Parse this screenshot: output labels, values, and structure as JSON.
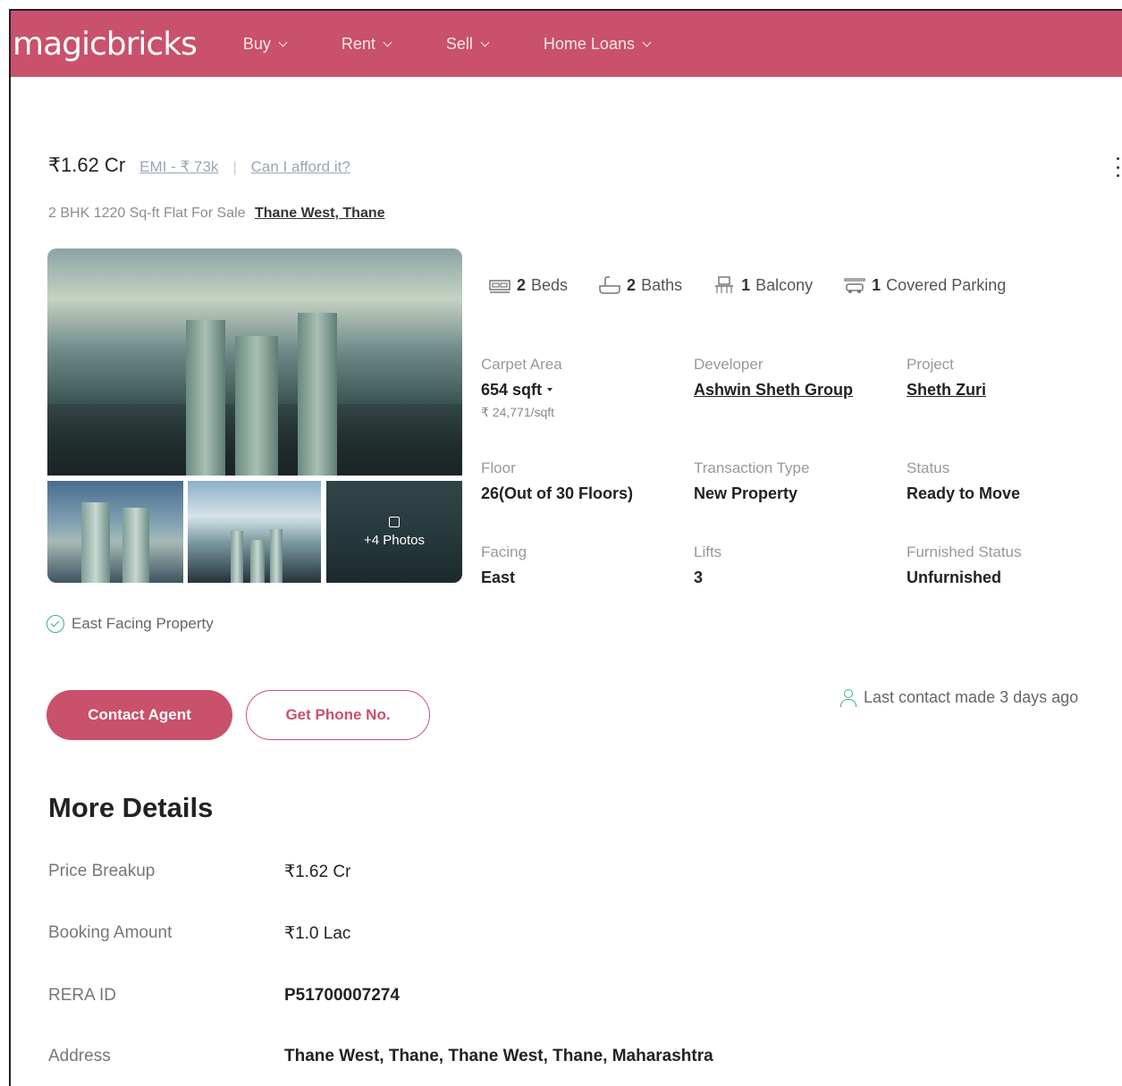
{
  "header": {
    "logo": "magicbricks",
    "nav": [
      "Buy",
      "Rent",
      "Sell",
      "Home Loans"
    ]
  },
  "listing": {
    "price": "₹1.62 Cr",
    "emi": "EMI - ₹ 73k",
    "separator": "|",
    "afford": "Can I afford it?",
    "subtitle": "2 BHK 1220 Sq-ft Flat For Sale",
    "location": "Thane West, Thane"
  },
  "gallery": {
    "more_photos": "+4 Photos"
  },
  "amenities": {
    "beds_count": "2",
    "beds_label": "Beds",
    "baths_count": "2",
    "baths_label": "Baths",
    "balcony_count": "1",
    "balcony_label": "Balcony",
    "parking_count": "1",
    "parking_label": "Covered Parking"
  },
  "attributes": {
    "carpet_area_label": "Carpet Area",
    "carpet_area_value": "654 sqft",
    "carpet_area_rate": "₹ 24,771/sqft",
    "developer_label": "Developer",
    "developer_value": "Ashwin Sheth Group",
    "project_label": "Project",
    "project_value": "Sheth Zuri",
    "floor_label": "Floor",
    "floor_value": "26(Out of 30 Floors)",
    "transaction_label": "Transaction Type",
    "transaction_value": "New Property",
    "status_label": "Status",
    "status_value": "Ready to Move",
    "facing_label": "Facing",
    "facing_value": "East",
    "lifts_label": "Lifts",
    "lifts_value": "3",
    "furnished_label": "Furnished Status",
    "furnished_value": "Unfurnished"
  },
  "highlight": "East Facing Property",
  "actions": {
    "contact_agent": "Contact Agent",
    "get_phone": "Get Phone No."
  },
  "last_contact": "Last contact made 3 days ago",
  "more_details": {
    "title": "More Details",
    "rows": [
      {
        "label": "Price Breakup",
        "value": "₹1.62 Cr"
      },
      {
        "label": "Booking Amount",
        "value": "₹1.0 Lac"
      },
      {
        "label": "RERA ID",
        "value": "P51700007274"
      },
      {
        "label": "Address",
        "value": "Thane West, Thane, Thane West, Thane, Maharashtra"
      }
    ]
  },
  "colors": {
    "brand": "#c9516b",
    "success": "#36b37e"
  }
}
